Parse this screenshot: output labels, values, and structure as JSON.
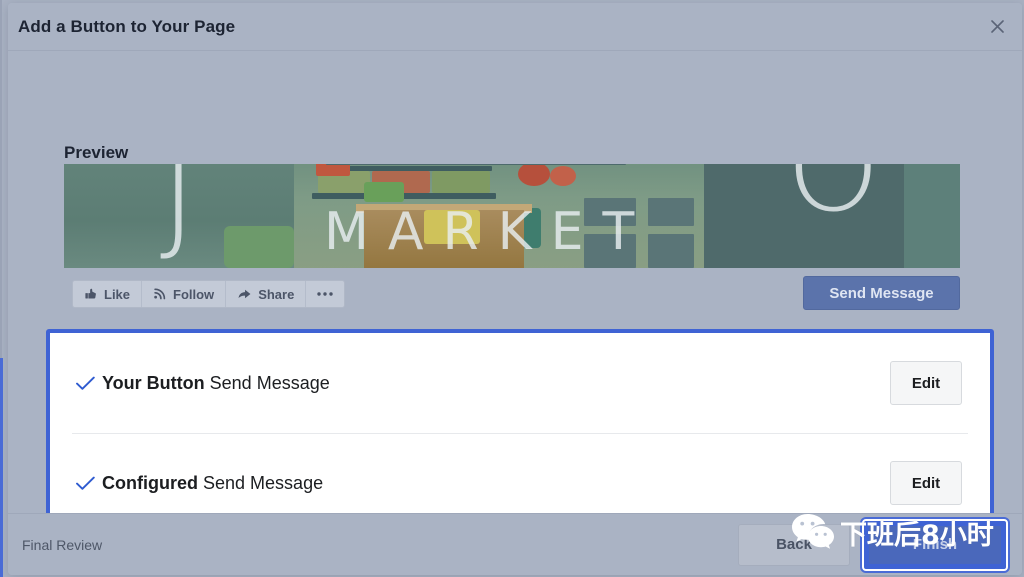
{
  "dialog": {
    "title": "Add a Button to Your Page",
    "close_icon": "close-icon"
  },
  "preview": {
    "label": "Preview",
    "cover": {
      "logo_left": "J",
      "logo_right": "O",
      "wordmark": "MARKET"
    },
    "action_buttons": [
      {
        "label": "Like",
        "icon": "thumbs-up-icon"
      },
      {
        "label": "Follow",
        "icon": "rss-follow-icon"
      },
      {
        "label": "Share",
        "icon": "share-arrow-icon"
      },
      {
        "label": "···",
        "icon": "more-options-icon"
      }
    ],
    "cta_button": "Send Message"
  },
  "review_panel": {
    "border_color": "#3f63d4",
    "rows": [
      {
        "check_icon": "checkmark-icon",
        "title": "Your Button",
        "value": "Send Message",
        "action": "Edit"
      },
      {
        "check_icon": "checkmark-icon",
        "title": "Configured",
        "value": "Send Message",
        "action": "Edit"
      }
    ]
  },
  "footer": {
    "step_label": "Final Review",
    "back_label": "Back",
    "finish_label": "Finish"
  },
  "watermark": {
    "text": "下班后8小时",
    "logo": "wechat-logo-icon"
  },
  "colors": {
    "accent_blue": "#3f63d4",
    "cta_blue": "#5b73ab",
    "overlay_gray": "#a9b2c3",
    "check_blue": "#2f5bd0"
  }
}
